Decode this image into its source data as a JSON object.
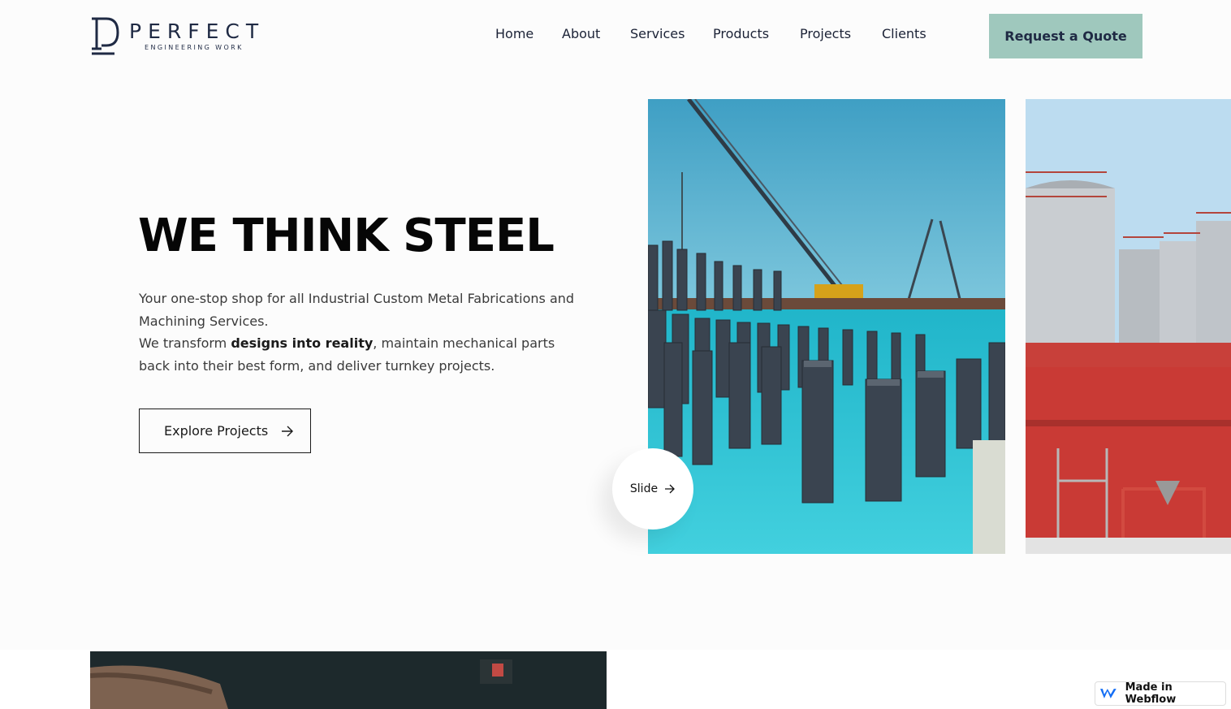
{
  "header": {
    "logo_word": "PERFECT",
    "logo_sub": "ENGINEERING WORK",
    "nav": [
      "Home",
      "About",
      "Services",
      "Products",
      "Projects",
      "Clients"
    ],
    "quote_label": "Request a Quote"
  },
  "hero": {
    "title": "WE THINK STEEL",
    "line1": "Your one-stop shop for all Industrial Custom Metal Fabrications and Machining Services.",
    "line2_pre": "We transform ",
    "line2_bold": "designs into reality",
    "line2_post": ", maintain mechanical parts back into their best form, and deliver turnkey projects.",
    "cta_label": "Explore Projects"
  },
  "slider": {
    "slide_label": "Slide"
  },
  "badge": {
    "label": "Made in Webflow"
  },
  "colors": {
    "accent": "#9fc8bd",
    "navy": "#1f2a44",
    "water": "#2ec6d6"
  },
  "icons": [
    "logo-mark-icon",
    "arrow-right-icon",
    "webflow-icon"
  ]
}
